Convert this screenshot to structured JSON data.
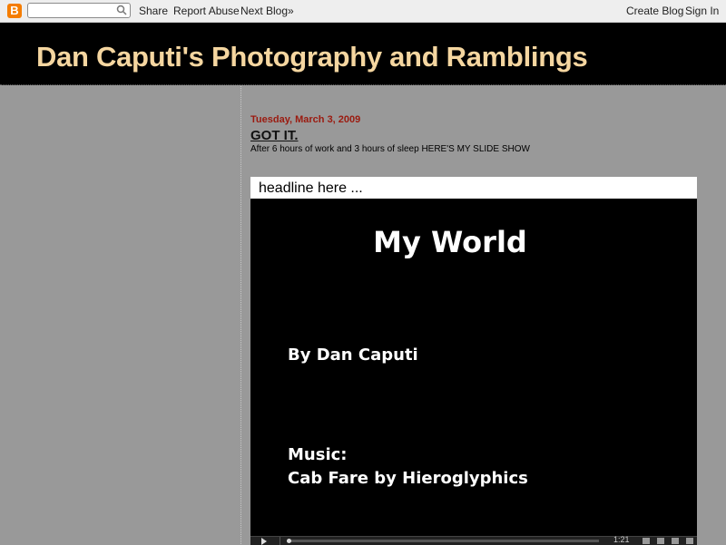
{
  "navbar": {
    "logo_letter": "B",
    "search": {
      "placeholder": "",
      "value": ""
    },
    "links": {
      "share": "Share",
      "report_abuse": "Report Abuse",
      "next_blog": "Next Blog»",
      "create_blog": "Create Blog",
      "sign_in": "Sign In"
    }
  },
  "header": {
    "title": "Dan Caputi's Photography and Ramblings"
  },
  "post": {
    "date": "Tuesday, March 3, 2009",
    "title": "GOT IT.",
    "body": "After 6 hours of work and 3 hours of sleep HERE'S MY SLIDE SHOW"
  },
  "slideshow": {
    "headline": "headline here ...",
    "slide_title": "My World",
    "byline": "By Dan Caputi",
    "music_label": "Music:",
    "music_track": "Cab Fare by Hieroglyphics",
    "time": "1:21"
  },
  "colors": {
    "page_background": "#999999",
    "header_background": "#000000",
    "title_color": "#f5d6a0",
    "date_color": "#9b1a0f",
    "blogger_orange": "#f57d00"
  }
}
